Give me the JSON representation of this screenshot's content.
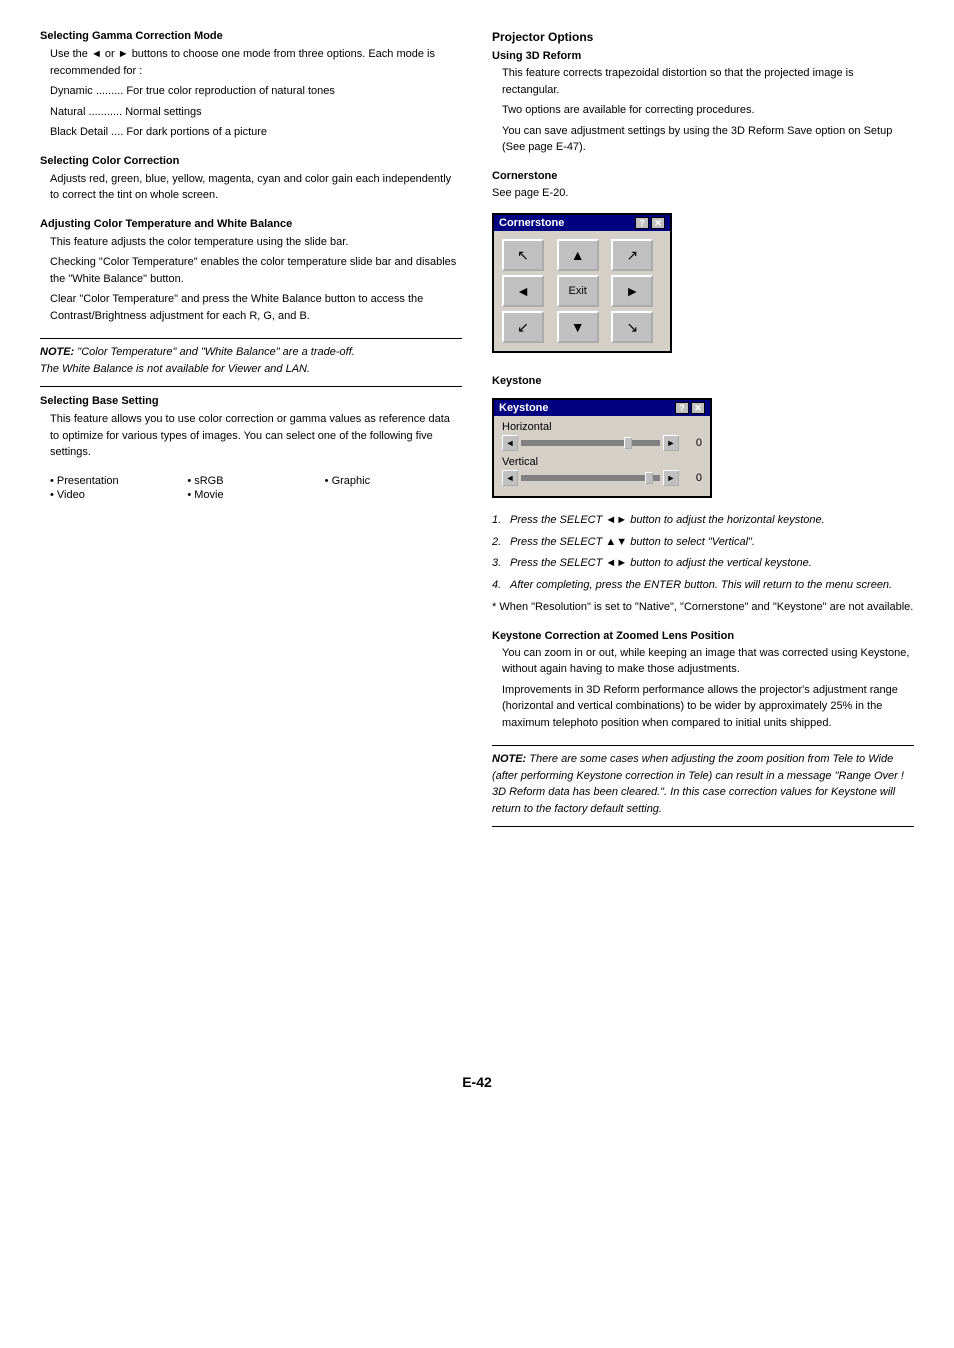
{
  "page": {
    "footer": "E-42"
  },
  "left": {
    "sections": [
      {
        "id": "gamma",
        "title": "Selecting Gamma Correction Mode",
        "paragraphs": [
          "Use the ◄ or ► buttons to choose one mode from three options. Each mode is recommended for :",
          "",
          "Dynamic ......... For true color reproduction of natural tones",
          "Natural ........... Normal settings",
          "Black Detail .... For dark portions of a picture"
        ]
      },
      {
        "id": "color-correction",
        "title": "Selecting Color Correction",
        "paragraphs": [
          "Adjusts red, green, blue, yellow, magenta, cyan and color gain each independently to correct the tint on whole screen."
        ]
      },
      {
        "id": "color-temp",
        "title": "Adjusting Color Temperature and White Balance",
        "paragraphs": [
          "This feature adjusts the color temperature using the slide bar.",
          "",
          "Checking \"Color Temperature\" enables the color temperature slide bar and disables the \"White Balance\" button.",
          "Clear \"Color Temperature\" and press the White Balance button to access the Contrast/Brightness adjustment for each R, G, and B."
        ]
      },
      {
        "id": "note1",
        "type": "note",
        "bold_prefix": "NOTE:",
        "text": " \"Color Temperature\" and \"White Balance\" are a trade-off.\nThe White Balance is not available for Viewer and LAN."
      },
      {
        "id": "base-setting",
        "title": "Selecting Base Setting",
        "paragraphs": [
          "This feature allows you to use color correction or gamma values as reference data to optimize for various types of images. You can select one of the following five settings."
        ]
      }
    ],
    "bullets": [
      {
        "col": 0,
        "text": "• Presentation"
      },
      {
        "col": 1,
        "text": "• sRGB"
      },
      {
        "col": 2,
        "text": "• Graphic"
      },
      {
        "col": 0,
        "text": "• Video"
      },
      {
        "col": 1,
        "text": "• Movie"
      }
    ]
  },
  "right": {
    "main_title": "Projector Options",
    "sections": [
      {
        "id": "3d-reform",
        "subtitle": "Using 3D Reform",
        "paragraphs": [
          "This feature corrects trapezoidal distortion so that the projected image is rectangular.",
          "Two options are available for correcting procedures.",
          "You can save adjustment settings by using the 3D Reform Save option on Setup (See page E-47)."
        ]
      },
      {
        "id": "cornerstone",
        "subtitle": "Cornerstone",
        "desc": "See page E-20."
      },
      {
        "id": "keystone",
        "subtitle": "Keystone"
      }
    ],
    "cornerstone_dialog": {
      "title": "Cornerstone",
      "buttons": [
        "?",
        "X"
      ],
      "grid": [
        [
          "↖",
          "▲",
          "↗"
        ],
        [
          "◄",
          "Exit",
          "►"
        ],
        [
          "↙",
          "▼",
          "↘"
        ]
      ]
    },
    "keystone_dialog": {
      "title": "Keystone",
      "title_buttons": [
        "?",
        "X"
      ],
      "horizontal_label": "Horizontal",
      "vertical_label": "Vertical",
      "h_value": "0",
      "v_value": "0"
    },
    "numbered_items": [
      "Press the SELECT ◄► button to adjust the horizontal keystone.",
      "Press the SELECT ▲▼ button to select \"Vertical\".",
      "Press the SELECT ◄► button to adjust the vertical keystone.",
      "After completing, press the ENTER button. This will return to the menu screen."
    ],
    "asterisk_note": "When \"Resolution\" is set to \"Native\", \"Cornerstone\" and \"Keystone\" are not available.",
    "keystone_correction": {
      "title": "Keystone Correction at Zoomed Lens Position",
      "paragraphs": [
        "You can zoom in or out, while keeping an image that was corrected using Keystone, without again having to make those adjustments.",
        "",
        "Improvements in 3D Reform performance allows the projector's adjustment range (horizontal and vertical combinations) to be wider by approximately 25% in the maximum telephoto position when compared to initial units shipped."
      ]
    },
    "note2": {
      "bold_prefix": "NOTE:",
      "text": " There are some cases when adjusting the zoom position from Tele to Wide (after performing Keystone correction in Tele) can result in a message \"Range Over ! 3D Reform data has been cleared.\". In this case correction values for Keystone will return to the factory default setting."
    }
  }
}
